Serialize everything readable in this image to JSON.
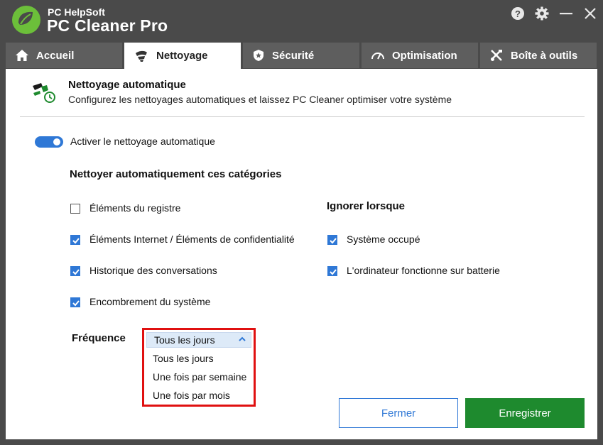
{
  "app": {
    "vendor": "PC HelpSoft",
    "name": "PC Cleaner Pro"
  },
  "tabs": [
    {
      "label": "Accueil",
      "icon": "home-icon"
    },
    {
      "label": "Nettoyage",
      "icon": "broom-icon"
    },
    {
      "label": "Sécurité",
      "icon": "shield-icon"
    },
    {
      "label": "Optimisation",
      "icon": "speedometer-icon"
    },
    {
      "label": "Boîte à outils",
      "icon": "tools-icon"
    }
  ],
  "active_tab": "Nettoyage",
  "header": {
    "title": "Nettoyage automatique",
    "subtitle": "Configurez les nettoyages automatiques et laissez PC Cleaner optimiser votre système",
    "icon": "auto-clean-icon"
  },
  "toggle": {
    "label": "Activer le nettoyage automatique",
    "on": true
  },
  "categories": {
    "title": "Nettoyer automatiquement ces catégories",
    "items": [
      {
        "label": "Éléments du registre",
        "checked": false
      },
      {
        "label": "Éléments Internet / Éléments de confidentialité",
        "checked": true
      },
      {
        "label": "Historique des conversations",
        "checked": true
      },
      {
        "label": "Encombrement du système",
        "checked": true
      }
    ]
  },
  "ignore": {
    "title": "Ignorer lorsque",
    "items": [
      {
        "label": "Système occupé",
        "checked": true
      },
      {
        "label": "L'ordinateur fonctionne sur batterie",
        "checked": true
      }
    ]
  },
  "frequency": {
    "label": "Fréquence",
    "selected": "Tous les jours",
    "options": [
      "Tous les jours",
      "Une fois par semaine",
      "Une fois par mois"
    ]
  },
  "buttons": {
    "close": "Fermer",
    "save": "Enregistrer"
  },
  "colors": {
    "accent": "#2f78d6",
    "save": "#1e8a2e",
    "highlight": "#e01010",
    "chrome": "#4a4a4a",
    "logo_green": "#6cbf3a"
  }
}
